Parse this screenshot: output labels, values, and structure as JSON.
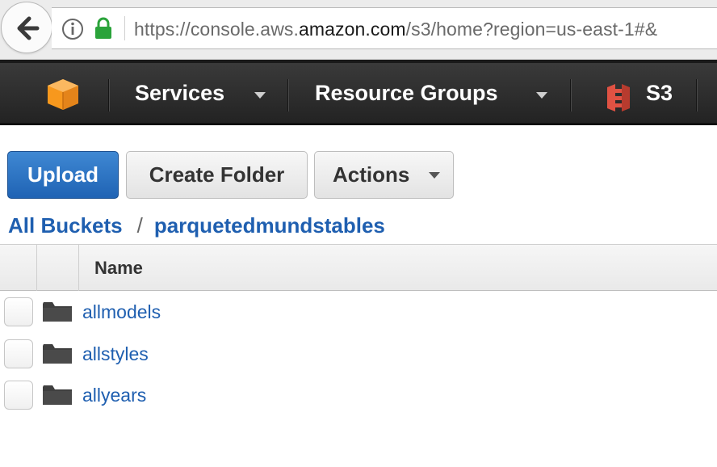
{
  "browser": {
    "url_host_prefix": "https://console.aws.",
    "url_host": "amazon.com",
    "url_path": "/s3/home?region=us-east-1#&"
  },
  "nav": {
    "services_label": "Services",
    "resource_groups_label": "Resource Groups",
    "service_label": "S3"
  },
  "toolbar": {
    "upload_label": "Upload",
    "create_folder_label": "Create Folder",
    "actions_label": "Actions"
  },
  "breadcrumb": {
    "root": "All Buckets",
    "separator": "/",
    "current": "parquetedmundstables"
  },
  "table": {
    "columns": [
      "Name"
    ],
    "rows": [
      {
        "name": "allmodels",
        "type": "folder"
      },
      {
        "name": "allstyles",
        "type": "folder"
      },
      {
        "name": "allyears",
        "type": "folder"
      }
    ]
  },
  "colors": {
    "link": "#1f5fb0",
    "primary_button": "#2a72c4",
    "nav_background": "#2b2b2b",
    "aws_orange": "#f7981d",
    "s3_red": "#e05243",
    "lock_green": "#2aa33a"
  },
  "icons": [
    "back-arrow-icon",
    "info-icon",
    "lock-icon",
    "aws-logo-icon",
    "s3-logo-icon",
    "folder-icon"
  ]
}
